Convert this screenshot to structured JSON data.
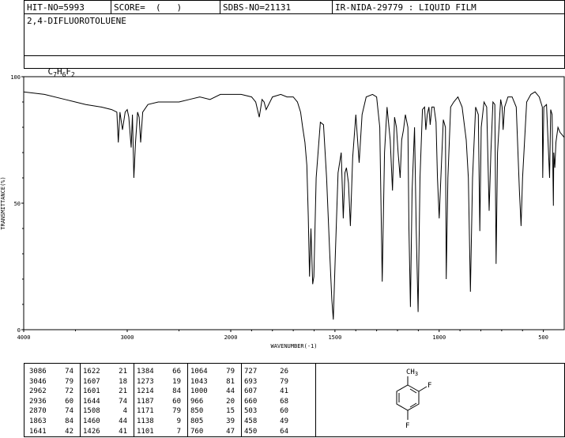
{
  "header": {
    "hit_no": "HIT-NO=5993",
    "score": "SCORE=  (   )",
    "sdbs_no": "SDBS-NO=21131",
    "ir_nida": "IR-NIDA-29779 : LIQUID FILM"
  },
  "compound_name": "2,4-DIFLUOROTOLUENE",
  "formula": {
    "c": "C",
    "c_sub": "7",
    "h": "H",
    "h_sub": "6",
    "f": "F",
    "f_sub": "2"
  },
  "chart_data": {
    "type": "line",
    "title": "",
    "xlabel": "WAVENUMBER(-1)",
    "ylabel": "TRANSMITTANCE(%)",
    "xlim": [
      4000,
      400
    ],
    "ylim": [
      0,
      100
    ],
    "x_ticks": [
      "4000",
      "3000",
      "2000",
      "1500",
      "1000",
      "500"
    ],
    "y_ticks": [
      "100",
      "50",
      "0"
    ],
    "grid": false,
    "series": [
      {
        "x": [
          4000,
          3800,
          3600,
          3400,
          3250,
          3150,
          3100,
          3086,
          3070,
          3046,
          3020,
          3000,
          2985,
          2962,
          2950,
          2936,
          2920,
          2900,
          2885,
          2870,
          2850,
          2800,
          2700,
          2600,
          2500,
          2400,
          2300,
          2200,
          2100,
          2000,
          1950,
          1900,
          1880,
          1863,
          1850,
          1840,
          1830,
          1800,
          1760,
          1730,
          1700,
          1680,
          1665,
          1655,
          1644,
          1635,
          1628,
          1622,
          1615,
          1607,
          1601,
          1590,
          1570,
          1555,
          1540,
          1525,
          1515,
          1508,
          1498,
          1485,
          1470,
          1460,
          1452,
          1445,
          1435,
          1426,
          1415,
          1400,
          1384,
          1370,
          1350,
          1320,
          1300,
          1285,
          1273,
          1262,
          1250,
          1235,
          1224,
          1214,
          1205,
          1197,
          1187,
          1180,
          1171,
          1162,
          1150,
          1145,
          1138,
          1130,
          1118,
          1110,
          1101,
          1092,
          1080,
          1070,
          1064,
          1057,
          1049,
          1043,
          1035,
          1025,
          1015,
          1008,
          1000,
          992,
          980,
          970,
          966,
          958,
          945,
          930,
          910,
          890,
          870,
          860,
          850,
          840,
          825,
          812,
          805,
          798,
          785,
          772,
          760,
          752,
          742,
          733,
          727,
          720,
          705,
          698,
          693,
          686,
          670,
          650,
          630,
          615,
          607,
          600,
          580,
          560,
          540,
          520,
          505,
          503,
          498,
          485,
          470,
          465,
          458,
          452,
          450,
          445,
          440,
          430,
          420,
          410,
          400
        ],
        "y": [
          94,
          93,
          91,
          89,
          88,
          87,
          86,
          74,
          86,
          79,
          86,
          87,
          84,
          72,
          85,
          60,
          74,
          86,
          84,
          74,
          86,
          89,
          90,
          90,
          90,
          91,
          92,
          91,
          93,
          93,
          93,
          92,
          90,
          84,
          91,
          90,
          87,
          92,
          93,
          92,
          92,
          90,
          86,
          80,
          74,
          65,
          45,
          21,
          40,
          18,
          21,
          60,
          82,
          81,
          60,
          30,
          12,
          4,
          30,
          62,
          70,
          44,
          62,
          64,
          58,
          41,
          68,
          85,
          66,
          85,
          92,
          93,
          92,
          80,
          19,
          70,
          88,
          75,
          55,
          84,
          80,
          70,
          60,
          75,
          79,
          85,
          80,
          40,
          9,
          55,
          80,
          40,
          7,
          60,
          87,
          88,
          79,
          85,
          88,
          81,
          88,
          88,
          82,
          60,
          44,
          60,
          83,
          80,
          20,
          60,
          88,
          90,
          92,
          88,
          75,
          60,
          15,
          60,
          88,
          85,
          39,
          80,
          90,
          88,
          47,
          70,
          90,
          89,
          26,
          70,
          91,
          88,
          79,
          88,
          92,
          92,
          88,
          55,
          41,
          60,
          90,
          93,
          94,
          92,
          88,
          60,
          88,
          89,
          60,
          87,
          85,
          49,
          70,
          64,
          74,
          80,
          78,
          77,
          76
        ]
      }
    ]
  },
  "peak_table": [
    [
      [
        "3086",
        "74"
      ],
      [
        "3046",
        "79"
      ],
      [
        "2962",
        "72"
      ],
      [
        "2936",
        "60"
      ],
      [
        "2870",
        "74"
      ],
      [
        "1863",
        "84"
      ],
      [
        "1641",
        "42"
      ]
    ],
    [
      [
        "1622",
        "21"
      ],
      [
        "1607",
        "18"
      ],
      [
        "1601",
        "21"
      ],
      [
        "1644",
        "74"
      ],
      [
        "1508",
        "4"
      ],
      [
        "1460",
        "44"
      ],
      [
        "1426",
        "41"
      ]
    ],
    [
      [
        "1384",
        "66"
      ],
      [
        "1273",
        "19"
      ],
      [
        "1214",
        "84"
      ],
      [
        "1187",
        "60"
      ],
      [
        "1171",
        "79"
      ],
      [
        "1138",
        "9"
      ],
      [
        "1101",
        "7"
      ]
    ],
    [
      [
        "1064",
        "79"
      ],
      [
        "1043",
        "81"
      ],
      [
        "1000",
        "44"
      ],
      [
        "966",
        "20"
      ],
      [
        "850",
        "15"
      ],
      [
        "805",
        "39"
      ],
      [
        "760",
        "47"
      ]
    ],
    [
      [
        "727",
        "26"
      ],
      [
        "693",
        "79"
      ],
      [
        "607",
        "41"
      ],
      [
        "660",
        "68"
      ],
      [
        "503",
        "60"
      ],
      [
        "458",
        "49"
      ],
      [
        "450",
        "64"
      ]
    ]
  ],
  "structure": {
    "methyl": "CH",
    "methyl_sub": "3",
    "f1": "F",
    "f2": "F"
  }
}
